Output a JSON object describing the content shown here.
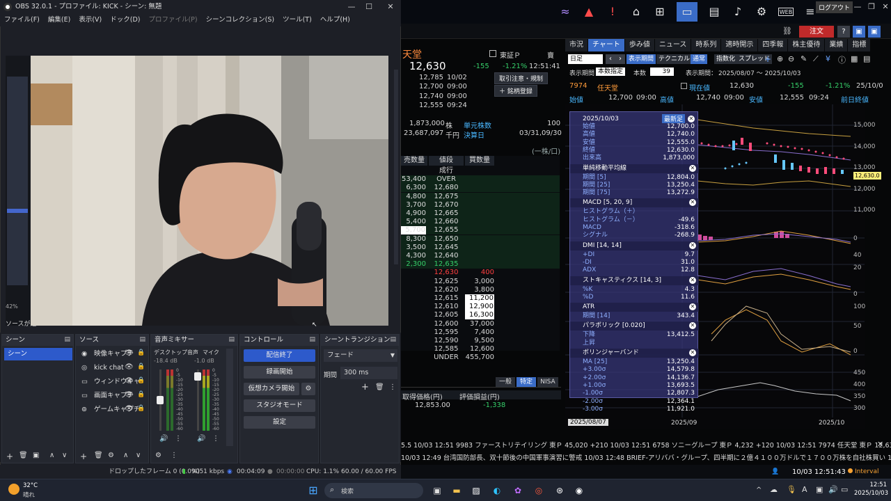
{
  "obs": {
    "title": "OBS 32.0.1 - プロファイル: KICK - シーン: 無題",
    "menu": [
      "ファイル(F)",
      "編集(E)",
      "表示(V)",
      "ドック(D)",
      "プロファイル(P)",
      "シーンコレクション(S)",
      "ツール(T)",
      "ヘルプ(H)"
    ],
    "docks": {
      "scenes": {
        "title": "シーン",
        "items": [
          "シーン"
        ]
      },
      "sources": {
        "title": "ソース",
        "items": [
          "映像キャプチ",
          "kick chat",
          "ウィンドウキャ",
          "画面キャプチ",
          "ゲームキャプチ"
        ]
      },
      "mixer": {
        "title": "音声ミキサー",
        "ch1": {
          "name": "デスクトップ音声",
          "db": "-18.4 dB"
        },
        "ch2": {
          "name": "マイク",
          "db": "-1.0 dB"
        },
        "scale": [
          "0",
          "-5",
          "-10",
          "-15",
          "-20",
          "-25",
          "-30",
          "-35",
          "-40",
          "-45",
          "-50",
          "-55",
          "-60"
        ]
      },
      "controls": {
        "title": "コントロール",
        "buttons": [
          "配信終了",
          "録画開始",
          "仮想カメラ開始",
          "スタジオモード",
          "設定"
        ]
      },
      "transitions": {
        "title": "シーントランジション",
        "type": "フェード",
        "duration_label": "期間",
        "duration": "300 ms"
      }
    },
    "status": {
      "dropped": "ドロップしたフレーム 0 (0.0%)",
      "bitrate": "9051 kbps",
      "stream_time": "00:04:09",
      "rec_time": "00:00:00",
      "cpu": "CPU: 1.1%",
      "fps": "60.00 / 60.00 FPS"
    },
    "preview_left": {
      "zoom": "42%",
      "hint": "ソースが選"
    }
  },
  "trade": {
    "login": "ログアウト",
    "order": "注文",
    "web": "WEB",
    "stock": {
      "name_partial": "天堂",
      "market": "東証Ｐ",
      "last": "12,630",
      "change": "-155",
      "change_pct": "-1.21%",
      "time": "12:51:41",
      "sell_label": "賣",
      "prev": [
        [
          "12,785",
          "10/02"
        ],
        [
          "12,700",
          "09:00"
        ],
        [
          "12,740",
          "09:00"
        ],
        [
          "12,555",
          "09:24"
        ]
      ],
      "btn_alert": "取引注意・規制",
      "btn_register": "銘柄登録",
      "volume": "1,873,000",
      "vol_unit": "株",
      "unit_label": "単元株数",
      "unit": "100",
      "turnover": "23,687,097",
      "turnover_unit": "千円",
      "settle_label": "決算日",
      "settle": "03/31,09/30",
      "lot_note": "(一株/口)"
    },
    "board": {
      "headers": [
        "売数量",
        "値段",
        "買数量"
      ],
      "rows": [
        [
          "",
          "成行",
          ""
        ],
        [
          "53,400",
          "OVER",
          ""
        ],
        [
          "6,300",
          "12,680",
          ""
        ],
        [
          "4,800",
          "12,675",
          ""
        ],
        [
          "3,700",
          "12,670",
          ""
        ],
        [
          "4,900",
          "12,665",
          ""
        ],
        [
          "5,400",
          "12,660",
          ""
        ],
        [
          "5,700",
          "12,655",
          ""
        ],
        [
          "8,300",
          "12,650",
          ""
        ],
        [
          "3,500",
          "12,645",
          ""
        ],
        [
          "4,300",
          "12,640",
          ""
        ],
        [
          "2,300",
          "12,635",
          ""
        ],
        [
          "",
          "12,630",
          "400"
        ],
        [
          "",
          "12,625",
          "3,000"
        ],
        [
          "",
          "12,620",
          "3,800"
        ],
        [
          "",
          "12,615",
          "11,200"
        ],
        [
          "",
          "12,610",
          "12,900"
        ],
        [
          "",
          "12,605",
          "16,300"
        ],
        [
          "",
          "12,600",
          "37,000"
        ],
        [
          "",
          "12,595",
          "7,400"
        ],
        [
          "",
          "12,590",
          "9,500"
        ],
        [
          "",
          "12,585",
          "12,600"
        ],
        [
          "",
          "UNDER",
          "455,700"
        ]
      ]
    },
    "account": {
      "tabs": [
        "一般",
        "特定",
        "NISA"
      ],
      "cost_label": "取得価格(円)",
      "pl_label": "評価損益(円)",
      "cost": "12,853.00",
      "pl": "-1,338"
    },
    "chart_tabs": [
      "市況",
      "チャート",
      "歩み値",
      "ニュース",
      "時系列",
      "適時開示",
      "四季報",
      "株主優待",
      "業績",
      "指標"
    ],
    "chart_tools": {
      "period": "日足",
      "display_period": "表示期間",
      "technical": "テクニカル",
      "normal": "通常",
      "index": "指数化",
      "spread": "スプレッド",
      "range_label": "表示期間：",
      "range_mode": "本数指定",
      "count_label": "本数",
      "count": "39",
      "range": "2025/08/07 ～ 2025/10/03"
    },
    "quote_line": {
      "code": "7974",
      "name": "任天堂",
      "now_label": "現在値",
      "now": "12,630",
      "chg": "-155",
      "pct": "-1.21%",
      "date": "25/10/0",
      "open_label": "始値",
      "open": "12,700",
      "open_t": "09:00",
      "high_label": "高値",
      "high": "12,740",
      "high_t": "09:00",
      "low_label": "安値",
      "low": "12,555",
      "low_t": "09:24",
      "prevclose_label": "前日終値"
    },
    "overlay": {
      "date": "2025/10/03",
      "latest": "最新足",
      "sections": [
        {
          "title": "",
          "rows": [
            [
              "始値",
              "12,700.0"
            ],
            [
              "高値",
              "12,740.0"
            ],
            [
              "安値",
              "12,555.0"
            ],
            [
              "終値",
              "12,630.0"
            ],
            [
              "出来高",
              "1,873,000"
            ]
          ]
        },
        {
          "title": "単純移動平均線",
          "rows": [
            [
              "期間 [5]",
              "12,804.0"
            ],
            [
              "期間 [25]",
              "13,250.4"
            ],
            [
              "期間 [75]",
              "13,272.9"
            ]
          ]
        },
        {
          "title": "MACD [5, 20, 9]",
          "rows": [
            [
              "ヒストグラム（＋）",
              ""
            ],
            [
              "ヒストグラム（－）",
              "-49.6"
            ],
            [
              "MACD",
              "-318.6"
            ],
            [
              "シグナル",
              "-268.9"
            ]
          ]
        },
        {
          "title": "DMI [14, 14]",
          "rows": [
            [
              "+DI",
              "9.7"
            ],
            [
              "-DI",
              "31.0"
            ],
            [
              "ADX",
              "12.8"
            ]
          ]
        },
        {
          "title": "ストキャスティクス [14, 3]",
          "rows": [
            [
              "%K",
              "4.3"
            ],
            [
              "%D",
              "11.6"
            ]
          ]
        },
        {
          "title": "ATR",
          "rows": [
            [
              "期間 [14]",
              "343.4"
            ]
          ]
        },
        {
          "title": "パラボリック [0.020]",
          "rows": [
            [
              "下降",
              "13,412.5"
            ],
            [
              "上昇",
              ""
            ]
          ]
        },
        {
          "title": "ボリンジャーバンド",
          "rows": [
            [
              "MA [25]",
              "13,250.4"
            ],
            [
              "+3.00σ",
              "14,579.8"
            ],
            [
              "+2.00σ",
              "14,136.7"
            ],
            [
              "+1.00σ",
              "13,693.5"
            ],
            [
              "-1.00σ",
              "12,807.3"
            ],
            [
              "-2.00σ",
              "12,364.1"
            ],
            [
              "-3.00σ",
              "11,921.0"
            ]
          ]
        }
      ]
    },
    "axis": [
      "15,000",
      "14,000",
      "13,000",
      "12,000",
      "11,000",
      "0",
      "40",
      "20",
      "0",
      "100",
      "50",
      "0",
      "450",
      "400",
      "350",
      "300"
    ],
    "price_tag": "12,630.0",
    "dates": [
      "2025/08/07",
      "2025/09",
      "2025/10"
    ],
    "ticker1": "5.5  10/03 12:51   9983 ファーストリテイリング  東Ｐ 45,020 +210  10/03 12:51   6758 ソニーグループ  東Ｐ 4,232 +120  10/03 12:51   7974 任天堂  東Ｐ 12,63",
    "ticker2": "10/03 12:49  台湾国防部長、双十節後の中国軍事演習に警戒   10/03 12:48  BRIEF-アリババ・グループ、四半期に２億４１００万ドルで１７００万株を自社株買い   10/03 12:37",
    "clock": "10/03 12:51:43",
    "interval": "Interval"
  },
  "taskbar": {
    "temp": "32°C",
    "weather": "晴れ",
    "search": "検索",
    "time": "12:51",
    "date": "2025/10/03"
  }
}
